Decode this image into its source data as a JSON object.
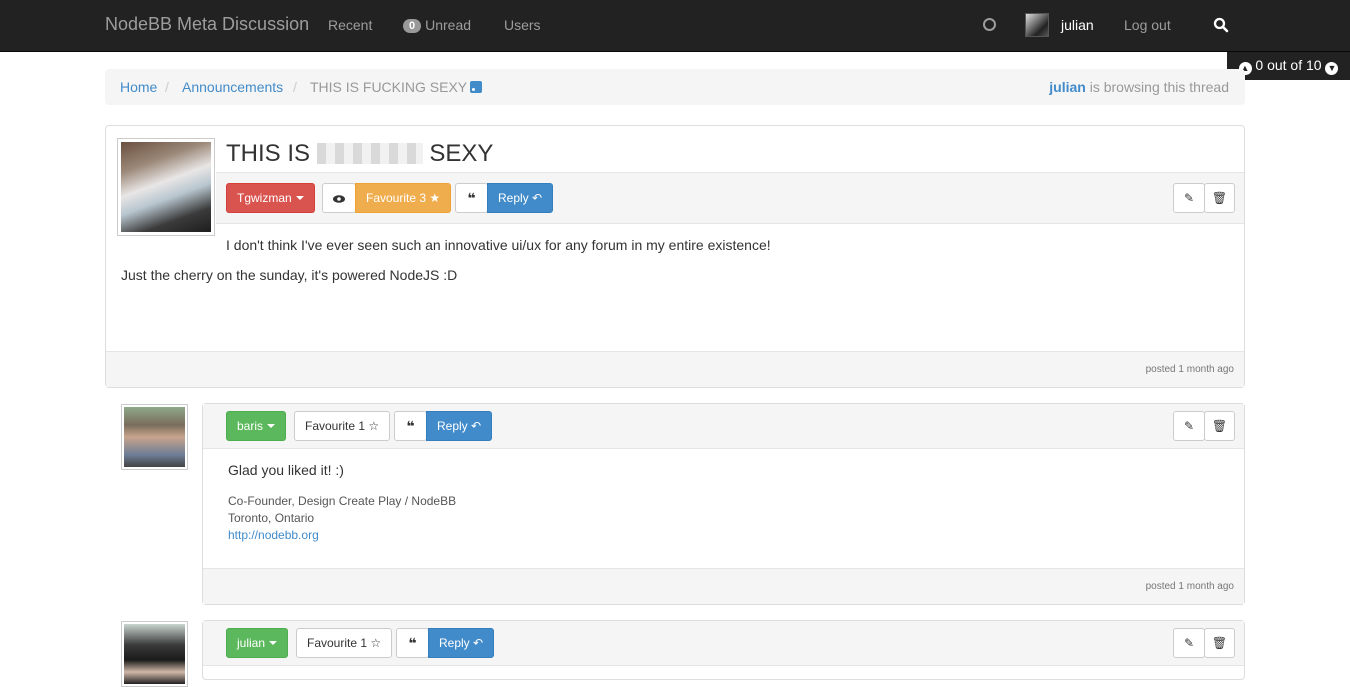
{
  "navbar": {
    "brand": "NodeBB Meta Discussion",
    "recent": "Recent",
    "unread_count": "0",
    "unread": "Unread",
    "users": "Users",
    "username": "julian",
    "logout": "Log out"
  },
  "pagination": {
    "text": "0 out of 10"
  },
  "breadcrumb": {
    "home": "Home",
    "category": "Announcements",
    "current": "THIS IS FUCKING SEXY",
    "browsing_user": "julian",
    "browsing_text": "is browsing this thread"
  },
  "main_post": {
    "title_start": "THIS IS",
    "title_end": "SEXY",
    "author": "Tgwizman",
    "favourite_label": "Favourite",
    "favourite_count": "3",
    "reply_label": "Reply",
    "text_line1": "I don't think I've ever seen such an innovative ui/ux for any forum in my entire existence!",
    "text_line2": "Just the cherry on the sunday, it's powered NodeJS :D",
    "posted": "posted 1 month ago"
  },
  "posts": [
    {
      "author": "baris",
      "favourite_label": "Favourite",
      "favourite_count": "1",
      "reply_label": "Reply",
      "text": "Glad you liked it! :)",
      "signature": [
        "Co-Founder, Design Create Play / NodeBB",
        "Toronto, Ontario",
        "http://nodebb.org"
      ],
      "posted": "posted 1 month ago"
    },
    {
      "author": "julian",
      "favourite_label": "Favourite",
      "favourite_count": "1",
      "reply_label": "Reply"
    }
  ],
  "colors": {
    "navbar_bg": "#222222",
    "link": "#428bca",
    "danger": "#d9534f",
    "success": "#5cb85c",
    "warning": "#f0ad4e",
    "primary": "#428bca"
  },
  "icons": [
    "circle-status-icon",
    "search-icon",
    "arrow-circle-up-icon",
    "arrow-circle-down-icon",
    "rss-icon",
    "eye-icon",
    "star-icon",
    "star-outline-icon",
    "quote-icon",
    "reply-icon",
    "pencil-icon",
    "trash-icon",
    "caret-down-icon"
  ]
}
